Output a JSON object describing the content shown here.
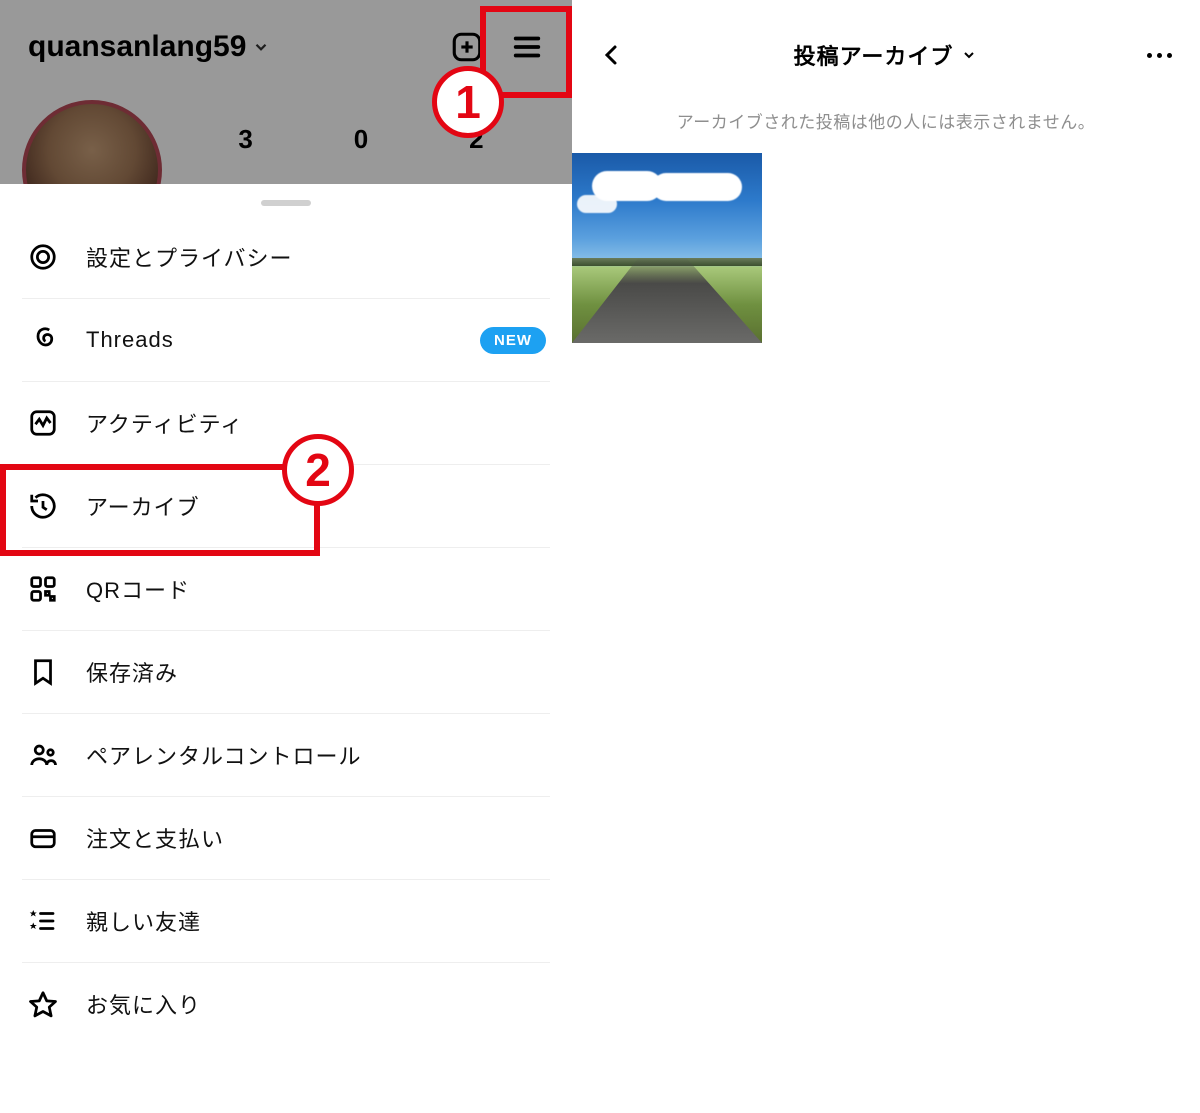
{
  "left": {
    "username": "quansanlang59",
    "stats": {
      "posts": "3",
      "followers": "0",
      "following": "2"
    },
    "annotations": {
      "one": "1",
      "two": "2"
    }
  },
  "sheet": {
    "items": [
      {
        "key": "settings",
        "label": "設定とプライバシー",
        "badge": null
      },
      {
        "key": "threads",
        "label": "Threads",
        "badge": "NEW"
      },
      {
        "key": "activity",
        "label": "アクティビティ",
        "badge": null
      },
      {
        "key": "archive",
        "label": "アーカイブ",
        "badge": null
      },
      {
        "key": "qr",
        "label": "QRコード",
        "badge": null
      },
      {
        "key": "saved",
        "label": "保存済み",
        "badge": null
      },
      {
        "key": "parental",
        "label": "ペアレンタルコントロール",
        "badge": null
      },
      {
        "key": "orders",
        "label": "注文と支払い",
        "badge": null
      },
      {
        "key": "close",
        "label": "親しい友達",
        "badge": null
      },
      {
        "key": "fav",
        "label": "お気に入り",
        "badge": null
      }
    ]
  },
  "right": {
    "title": "投稿アーカイブ",
    "message": "アーカイブされた投稿は他の人には表示されません。"
  }
}
